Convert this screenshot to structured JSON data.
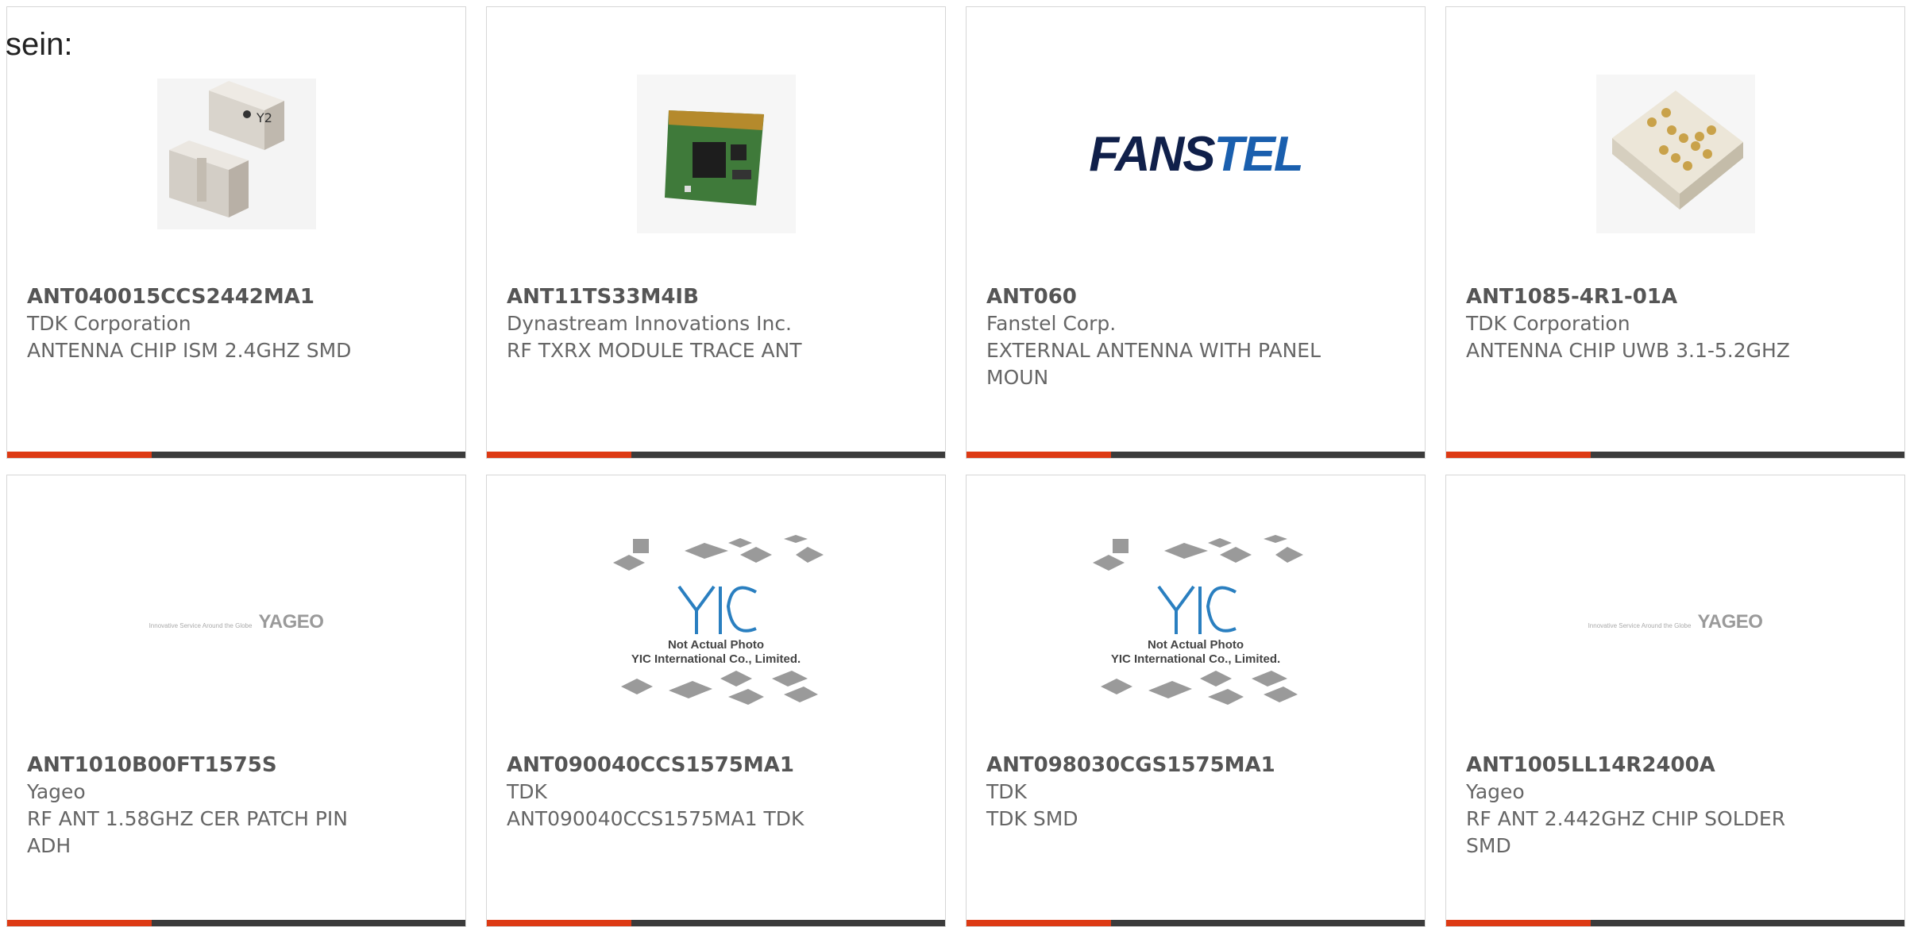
{
  "intro_text": "sein:",
  "cards": [
    {
      "part": "ANT040015CCS2442MA1",
      "manufacturer": "TDK Corporation",
      "description": "ANTENNA CHIP ISM 2.4GHZ SMD",
      "image": "chip-antenna-photo"
    },
    {
      "part": "ANT11TS33M4IB",
      "manufacturer": "Dynastream Innovations Inc.",
      "description": "RF TXRX MODULE TRACE ANT",
      "image": "pcb-module-photo"
    },
    {
      "part": "ANT060",
      "manufacturer": "Fanstel Corp.",
      "description": "EXTERNAL ANTENNA WITH PANEL MOUN",
      "image": "fanstel-logo",
      "logo_text_a": "FANS",
      "logo_text_b": "TEL"
    },
    {
      "part": "ANT1085-4R1-01A",
      "manufacturer": "TDK Corporation",
      "description": "ANTENNA CHIP UWB 3.1-5.2GHZ",
      "image": "uwb-chip-photo"
    },
    {
      "part": "ANT1010B00FT1575S",
      "manufacturer": "Yageo",
      "description": "RF ANT 1.58GHZ CER PATCH PIN ADH",
      "image": "yageo-logo",
      "logo_tagline": "Innovative Service Around the Globe",
      "logo_text": "YAGEO"
    },
    {
      "part": "ANT090040CCS1575MA1",
      "manufacturer": "TDK",
      "description": "ANT090040CCS1575MA1 TDK",
      "image": "yic-placeholder",
      "caption_1": "Not Actual Photo",
      "caption_2": "YIC International Co., Limited."
    },
    {
      "part": "ANT098030CGS1575MA1",
      "manufacturer": "TDK",
      "description": "TDK SMD",
      "image": "yic-placeholder",
      "caption_1": "Not Actual Photo",
      "caption_2": "YIC International Co., Limited."
    },
    {
      "part": "ANT1005LL14R2400A",
      "manufacturer": "Yageo",
      "description": "RF ANT 2.442GHZ CHIP SOLDER SMD",
      "image": "yageo-logo",
      "logo_tagline": "Innovative Service Around the Globe",
      "logo_text": "YAGEO"
    }
  ],
  "colors": {
    "accent": "#dd3a14",
    "bar": "#3b3b3b",
    "border": "#d6d6d6"
  }
}
